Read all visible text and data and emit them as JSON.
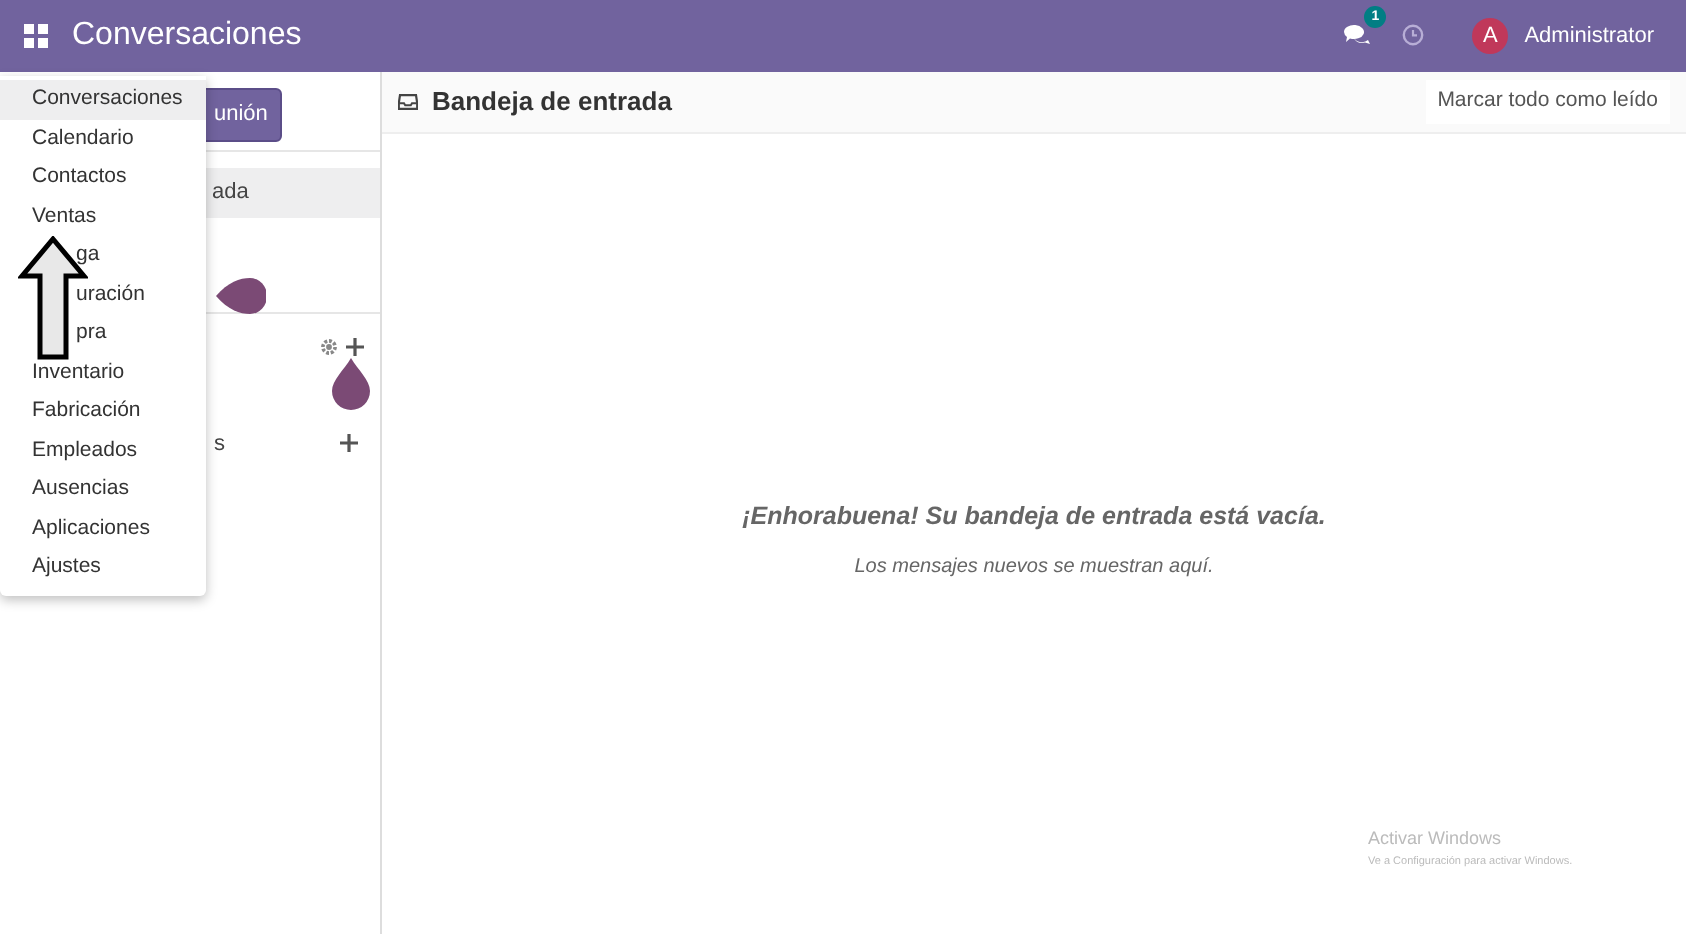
{
  "navbar": {
    "app_title": "Conversaciones",
    "message_count": "1",
    "avatar_letter": "A",
    "user": "Administrator"
  },
  "sidebar": {
    "button": "unión",
    "items": [
      {
        "label": "ada",
        "selected": true
      }
    ],
    "section_label": "s"
  },
  "app_menu": [
    {
      "label": "Conversaciones",
      "selected": true,
      "kind": "plain"
    },
    {
      "label": "Calendario",
      "selected": false,
      "kind": "plain"
    },
    {
      "label": "Contactos",
      "selected": false,
      "kind": "plain"
    },
    {
      "label": "Ventas",
      "selected": false,
      "kind": "plain"
    },
    {
      "label": "ga",
      "selected": false,
      "kind": "covered"
    },
    {
      "label": "uración",
      "selected": false,
      "kind": "covered"
    },
    {
      "label": "pra",
      "selected": false,
      "kind": "covered"
    },
    {
      "label": "Inventario",
      "selected": false,
      "kind": "plain"
    },
    {
      "label": "Fabricación",
      "selected": false,
      "kind": "plain"
    },
    {
      "label": "Empleados",
      "selected": false,
      "kind": "plain"
    },
    {
      "label": "Ausencias",
      "selected": false,
      "kind": "plain"
    },
    {
      "label": "Aplicaciones",
      "selected": false,
      "kind": "plain"
    },
    {
      "label": "Ajustes",
      "selected": false,
      "kind": "plain"
    }
  ],
  "main": {
    "title": "Bandeja de entrada",
    "mark_all_button": "Marcar todo como leído",
    "empty_title": "¡Enhorabuena! Su bandeja de entrada está vacía.",
    "empty_hint": "Los mensajes nuevos se muestran aquí."
  },
  "os_notice": {
    "title": "Activar Windows",
    "hint": "Ve a Configuración para activar Windows."
  }
}
